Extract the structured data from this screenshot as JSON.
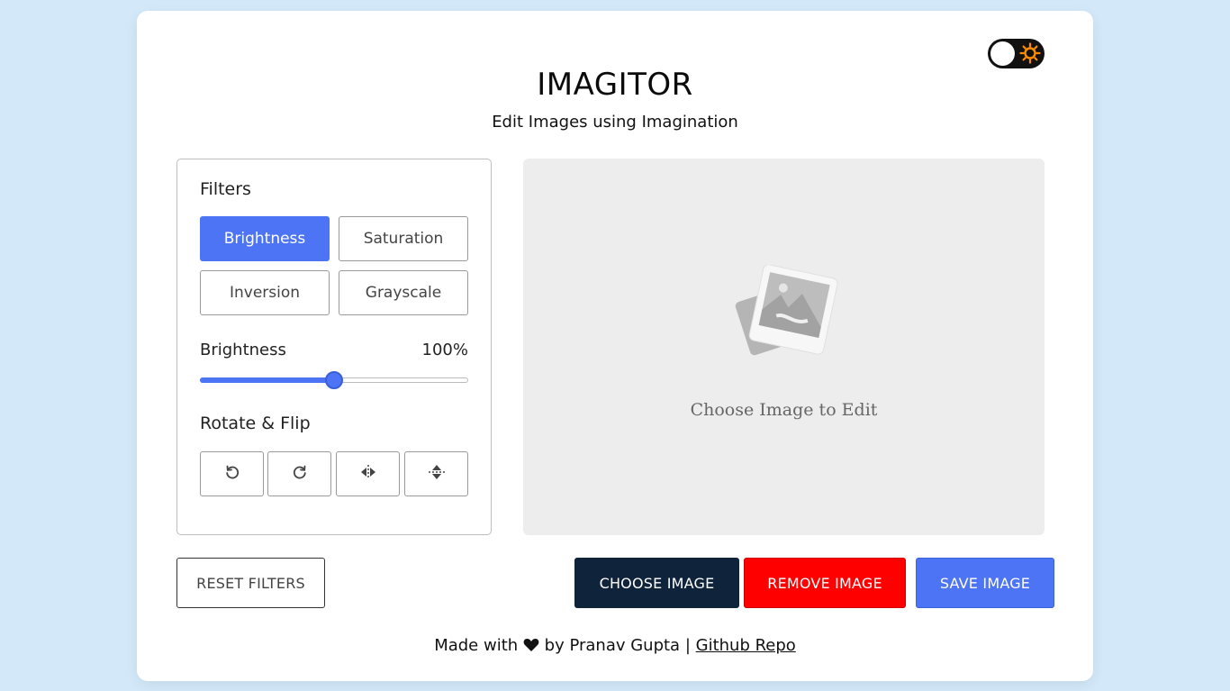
{
  "header": {
    "title": "IMAGITOR",
    "subtitle": "Edit Images using Imagination",
    "theme_toggle_icon": "sun-icon"
  },
  "filters": {
    "heading": "Filters",
    "buttons": [
      {
        "label": "Brightness",
        "active": true
      },
      {
        "label": "Saturation",
        "active": false
      },
      {
        "label": "Inversion",
        "active": false
      },
      {
        "label": "Grayscale",
        "active": false
      }
    ],
    "slider": {
      "name": "Brightness",
      "value_text": "100%",
      "fraction": 0.5
    }
  },
  "rotate_flip": {
    "heading": "Rotate & Flip",
    "buttons": [
      {
        "icon": "rotate-left-icon"
      },
      {
        "icon": "rotate-right-icon"
      },
      {
        "icon": "flip-horizontal-icon"
      },
      {
        "icon": "flip-vertical-icon"
      }
    ]
  },
  "preview": {
    "placeholder_text": "Choose Image to Edit",
    "placeholder_icon": "image-placeholder-icon"
  },
  "actions": {
    "reset": "RESET FILTERS",
    "choose": "CHOOSE IMAGE",
    "remove": "REMOVE IMAGE",
    "save": "SAVE IMAGE"
  },
  "footer": {
    "made_with": "Made with",
    "by": "by Pranav Gupta |",
    "link": "Github Repo"
  },
  "colors": {
    "background": "#d3e9f9",
    "accent": "#4c74f5",
    "choose": "#0f233b",
    "remove": "#ff0000"
  }
}
